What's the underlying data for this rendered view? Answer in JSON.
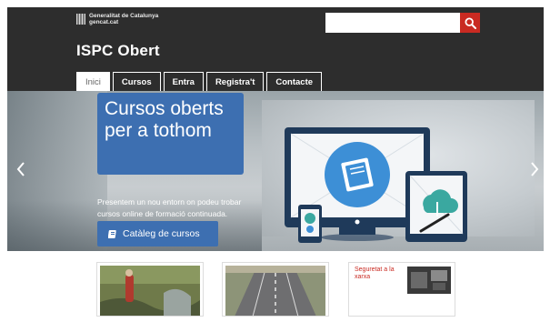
{
  "header": {
    "gencat_line1": "Generalitat de Catalunya",
    "gencat_line2": "gencat.cat",
    "site_title": "ISPC Obert",
    "background_color": "#2d2d2d"
  },
  "search": {
    "value": "",
    "placeholder": "",
    "button_icon": "search-icon",
    "button_color": "#c92a22"
  },
  "nav": {
    "tabs": [
      {
        "label": "Inici",
        "active": true
      },
      {
        "label": "Cursos",
        "active": false
      },
      {
        "label": "Entra",
        "active": false
      },
      {
        "label": "Registra't",
        "active": false
      },
      {
        "label": "Contacte",
        "active": false
      }
    ]
  },
  "hero": {
    "headline": "Cursos oberts per a tothom",
    "subtext": "Presentem un nou entorn on podeu trobar cursos online de formació continuada.",
    "cta_label": "Catàleg de cursos",
    "cta_icon": "book-icon",
    "accent_color": "#3d6fb1",
    "prev_icon": "chevron-left-icon",
    "next_icon": "chevron-right-icon"
  },
  "cards": {
    "card3_title": "Seguretat a la xarxa"
  }
}
